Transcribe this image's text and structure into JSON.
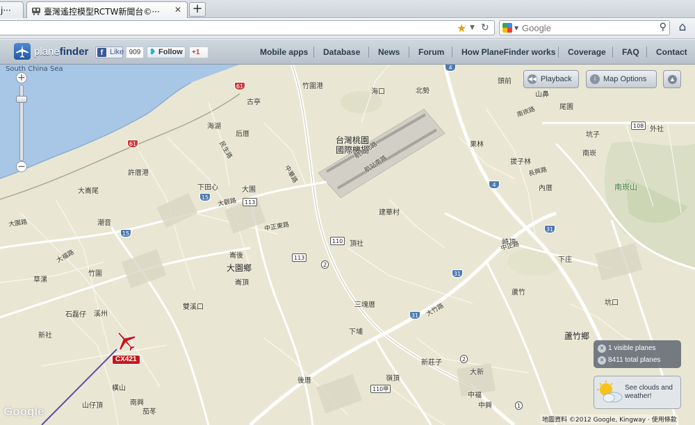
{
  "browser": {
    "tabs": [
      {
        "label": "j···"
      },
      {
        "label": "臺灣遙控模型RCTW新聞台©···"
      }
    ],
    "new_tab_symbol": "+",
    "search_placeholder": "Google"
  },
  "planefinder": {
    "logo": {
      "part1": "plane",
      "part2": "finder"
    },
    "social": {
      "like_label": "Like",
      "like_count": "909",
      "follow_label": "Follow",
      "gplus_label": "+1"
    },
    "nav": [
      "Mobile apps",
      "Database",
      "News",
      "Forum",
      "How PlaneFinder works",
      "Coverage",
      "FAQ",
      "Contact"
    ]
  },
  "map_controls": {
    "playback_label": "Playback",
    "map_options_label": "Map Options",
    "visible_planes": "1 visible planes",
    "total_planes": "8411 total planes",
    "weather_label": "See clouds and weather!"
  },
  "flight": {
    "callsign": "CX421"
  },
  "map_labels": {
    "sea": "South China Sea",
    "airport": "台灣桃園國際機場",
    "dayuan": "大園鄉",
    "luzhu": "蘆竹鄉",
    "nankan": "南崁山",
    "places": [
      "古亭",
      "海湖",
      "后厝",
      "大園",
      "下田心",
      "崙後",
      "崙頂",
      "雙溪口",
      "溪州",
      "竹圍",
      "大崙尾",
      "內厝",
      "三塊厝",
      "下埔",
      "新莊子",
      "蘆竹",
      "南崁",
      "外社",
      "坑子",
      "拔子林",
      "建華村",
      "頂社",
      "果林",
      "山鼻",
      "尾園",
      "頭前",
      "下庄",
      "大新",
      "中福",
      "中興",
      "山仔頂",
      "南興",
      "橫山",
      "嶺頂",
      "茄苳",
      "草漯",
      "石磊仔",
      "潮音",
      "許厝港",
      "竹圍港",
      "海口",
      "北勢",
      "崎頂",
      "新社",
      "後厝",
      "坑口"
    ],
    "roads": [
      "航站北路",
      "航站南路",
      "大觀路",
      "中正東路",
      "民生路",
      "大福路",
      "中華路",
      "大園路",
      "南崁路",
      "大竹路",
      "長興路",
      "中正路"
    ],
    "routes": {
      "r61a": "61",
      "r61b": "61",
      "r15a": "15",
      "r15b": "15",
      "r4a": "4",
      "r4b": "4",
      "r31a": "31",
      "r31b": "31",
      "r31c": "31",
      "r2a": "2",
      "r2b": "2",
      "r110a": "110",
      "r110b": "110甲",
      "r113a": "113",
      "r113b": "113",
      "r108": "108",
      "r1": "1"
    }
  },
  "attribution": "地圖資料 ©2012 Google, Kingway · 使用條款",
  "google_mark": "Google"
}
